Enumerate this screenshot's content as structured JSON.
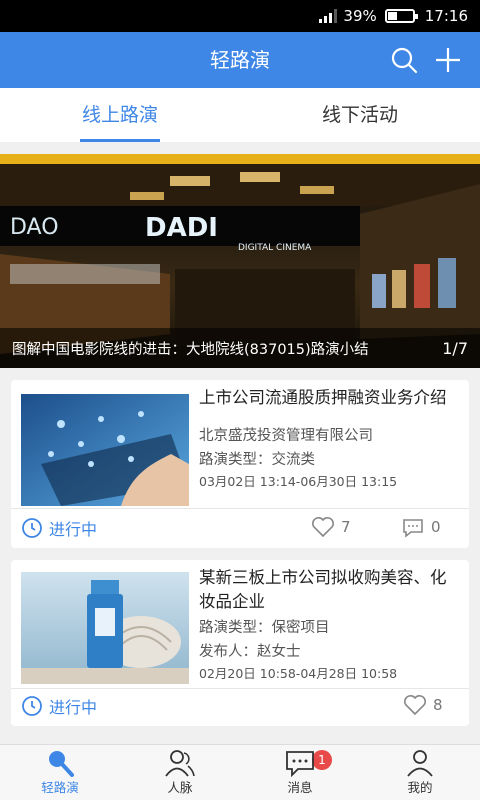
{
  "status_bar": {
    "battery_text": "39%",
    "battery_level": 0.39,
    "time": "17:16"
  },
  "header": {
    "title": "轻路演",
    "icons": [
      "search-icon",
      "plus-icon"
    ]
  },
  "tabs": [
    {
      "label": "线上路演",
      "active": true
    },
    {
      "label": "线下活动",
      "active": false
    }
  ],
  "banner": {
    "caption": "图解中国电影院线的进击：大地院线(837015)路演小结",
    "pager": "1/7",
    "sign_text": "DADI",
    "sign_text_partial": "DAO",
    "sign_subtext": "DIGITAL CINEMA"
  },
  "cards": [
    {
      "title": "上市公司流通股质押融资业务介绍",
      "lines": [
        "北京盛茂投资管理有限公司",
        "路演类型：交流类"
      ],
      "time": "03月02日 13:14-06月30日 13:15",
      "status": "进行中",
      "likes": "7",
      "comments": "0"
    },
    {
      "title": "某新三板上市公司拟收购美容、化妆品企业",
      "lines": [
        "路演类型：保密项目",
        "发布人：赵女士"
      ],
      "time": "02月20日 10:58-04月28日 10:58",
      "status": "进行中",
      "likes": "8"
    }
  ],
  "tabbar": [
    {
      "label": "轻路演",
      "icon": "mic-icon",
      "active": true
    },
    {
      "label": "人脉",
      "icon": "contacts-icon",
      "badge": "1"
    },
    {
      "label": "消息",
      "icon": "message-icon"
    },
    {
      "label": "我的",
      "icon": "profile-icon"
    }
  ],
  "colors": {
    "primary": "#3f87e6",
    "badge": "#e84a4a",
    "banner_strip": "#e8b018"
  }
}
